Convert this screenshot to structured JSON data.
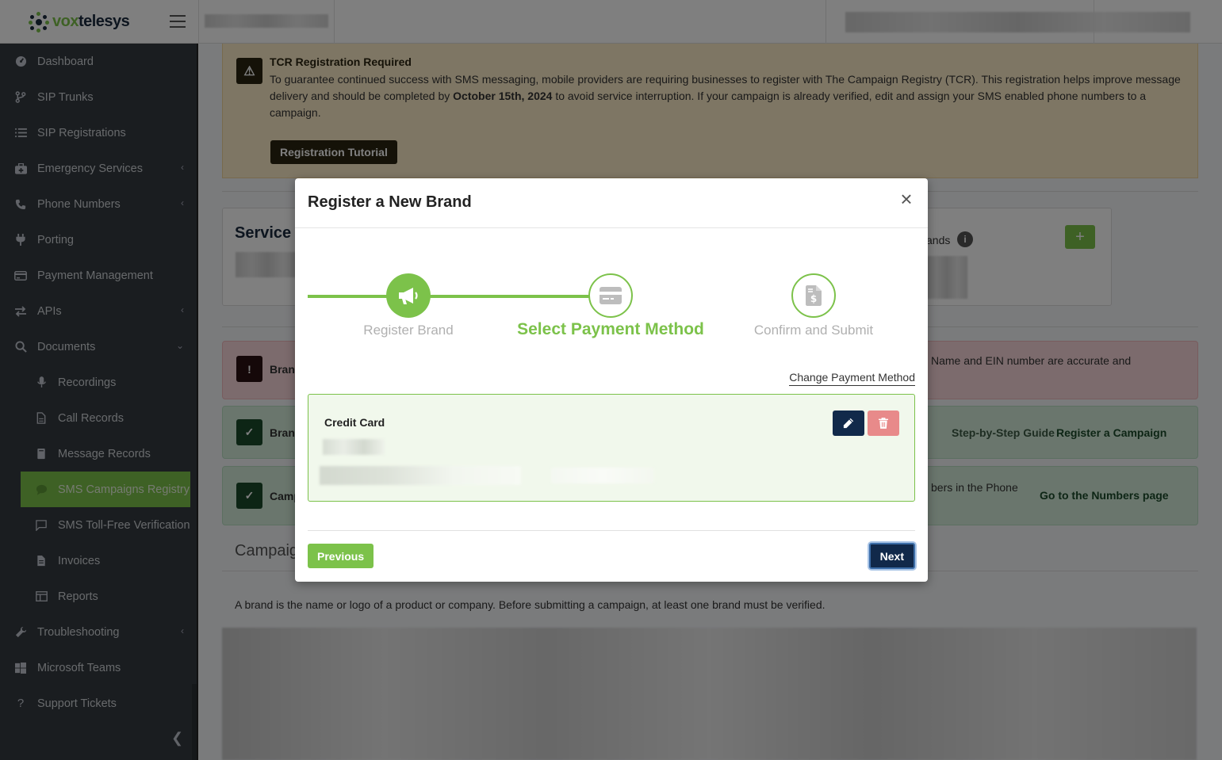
{
  "header": {
    "brand_prefix": "vox",
    "brand_suffix": "telesys"
  },
  "sidebar": {
    "items": [
      {
        "label": "Dashboard",
        "icon": "dashboard-icon"
      },
      {
        "label": "SIP Trunks",
        "icon": "branch-icon"
      },
      {
        "label": "SIP Registrations",
        "icon": "list-icon"
      },
      {
        "label": "Emergency Services",
        "icon": "first-aid-icon"
      },
      {
        "label": "Phone Numbers",
        "icon": "phone-icon"
      },
      {
        "label": "Porting",
        "icon": "plug-icon"
      },
      {
        "label": "Payment Management",
        "icon": "credit-card-icon"
      },
      {
        "label": "APIs",
        "icon": "exchange-icon"
      },
      {
        "label": "Documents",
        "icon": "search-icon"
      },
      {
        "label": "Recordings",
        "icon": "microphone-icon"
      },
      {
        "label": "Call Records",
        "icon": "file-icon"
      },
      {
        "label": "Message Records",
        "icon": "book-icon"
      },
      {
        "label": "SMS Campaigns Registry",
        "icon": "comment-icon"
      },
      {
        "label": "SMS Toll-Free Verification",
        "icon": "message-icon"
      },
      {
        "label": "Invoices",
        "icon": "invoice-icon"
      },
      {
        "label": "Reports",
        "icon": "table-icon"
      },
      {
        "label": "Troubleshooting",
        "icon": "wrench-icon"
      },
      {
        "label": "Microsoft Teams",
        "icon": "windows-icon"
      },
      {
        "label": "Support Tickets",
        "icon": "question-icon"
      }
    ]
  },
  "background": {
    "alert_title": "TCR Registration Required",
    "alert_body_1": "To guarantee continued success with SMS messaging, mobile providers are requiring businesses to register with The Campaign Registry (TCR). This registration helps improve message delivery and should be completed by ",
    "alert_deadline": "October 15th, 2024",
    "alert_body_2": " to avoid service interruption. If your campaign is already verified, edit and assign your SMS enabled phone numbers to a campaign.",
    "tutorial_button": "Registration Tutorial",
    "service_title": "Service T",
    "brands_fragment": "ands",
    "brand_row_1": "Branc",
    "brand_row_1_tail": "Name and EIN number are accurate and",
    "brand_row_2": "Branc",
    "guide_link": "Step-by-Step Guide",
    "register_campaign_link": "Register a Campaign",
    "campaign_row": "Camp",
    "campaign_row_tail": "bers in the Phone",
    "numbers_link": "Go to the Numbers page",
    "campaigns_heading": "Campaig",
    "brand_description": "A brand is the name or logo of a product or company. Before submitting a campaign, at least one brand must be verified."
  },
  "modal": {
    "title": "Register a New Brand",
    "steps": [
      {
        "label": "Register Brand",
        "state": "done"
      },
      {
        "label": "Select Payment Method",
        "state": "current"
      },
      {
        "label": "Confirm and Submit",
        "state": "todo"
      }
    ],
    "change_payment_link": "Change Payment Method",
    "payment_card_title": "Credit Card",
    "previous_button": "Previous",
    "next_button": "Next"
  },
  "colors": {
    "accent_green": "#7cc24a",
    "navy": "#11294a",
    "danger_light": "#e88a8a",
    "sidebar_bg": "#343a40"
  }
}
